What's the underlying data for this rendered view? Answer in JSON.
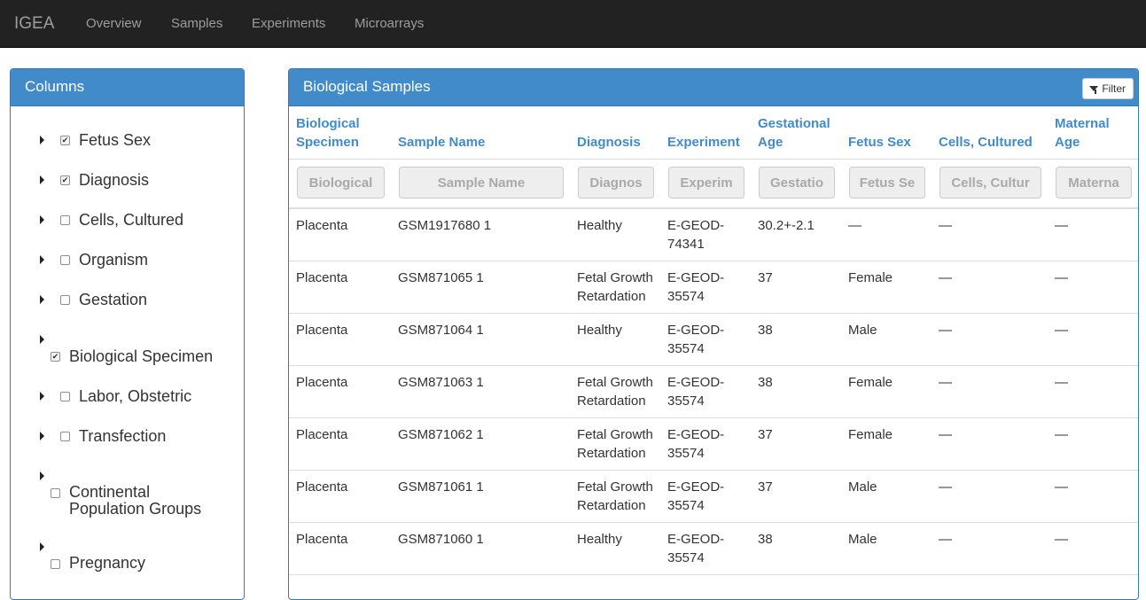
{
  "navbar": {
    "brand": "IGEA",
    "links": [
      "Overview",
      "Samples",
      "Experiments",
      "Microarrays"
    ]
  },
  "columns_panel": {
    "title": "Columns",
    "items": [
      {
        "label": "Fetus Sex",
        "checked": true
      },
      {
        "label": "Diagnosis",
        "checked": true
      },
      {
        "label": "Cells, Cultured",
        "checked": false
      },
      {
        "label": "Organism",
        "checked": false
      },
      {
        "label": "Gestation",
        "checked": false
      },
      {
        "label": "Biological Specimen",
        "checked": true
      },
      {
        "label": "Labor, Obstetric",
        "checked": false
      },
      {
        "label": "Transfection",
        "checked": false
      },
      {
        "label_line1": "Continental",
        "label_line2": "Population Groups",
        "checked": false
      },
      {
        "label": "Pregnancy",
        "checked": false
      }
    ]
  },
  "samples_panel": {
    "title": "Biological Samples",
    "filter_label": "Filter",
    "headers": [
      {
        "line1": "Biological",
        "line2": "Specimen"
      },
      {
        "line1": "",
        "line2": "Sample Name"
      },
      {
        "line1": "",
        "line2": "Diagnosis"
      },
      {
        "line1": "",
        "line2": "Experiment"
      },
      {
        "line1": "Gestational",
        "line2": "Age"
      },
      {
        "line1": "",
        "line2": "Fetus Sex"
      },
      {
        "line1": "",
        "line2": "Cells, Cultured"
      },
      {
        "line1": "Maternal",
        "line2": "Age"
      }
    ],
    "filters": [
      "Biological",
      "Sample Name",
      "Diagnos",
      "Experim",
      "Gestatio",
      "Fetus Se",
      "Cells, Cultur",
      "Materna"
    ],
    "rows": [
      {
        "specimen": "Placenta",
        "sample": "GSM1917680 1",
        "diag1": "Healthy",
        "diag2": "",
        "exp1": "E-GEOD-",
        "exp2": "74341",
        "age": "30.2+-2.1",
        "sex": "—",
        "cells": "—",
        "maternal": "—"
      },
      {
        "specimen": "Placenta",
        "sample": "GSM871065 1",
        "diag1": "Fetal Growth",
        "diag2": "Retardation",
        "exp1": "E-GEOD-",
        "exp2": "35574",
        "age": "37",
        "sex": "Female",
        "cells": "—",
        "maternal": "—"
      },
      {
        "specimen": "Placenta",
        "sample": "GSM871064 1",
        "diag1": "Healthy",
        "diag2": "",
        "exp1": "E-GEOD-",
        "exp2": "35574",
        "age": "38",
        "sex": "Male",
        "cells": "—",
        "maternal": "—"
      },
      {
        "specimen": "Placenta",
        "sample": "GSM871063 1",
        "diag1": "Fetal Growth",
        "diag2": "Retardation",
        "exp1": "E-GEOD-",
        "exp2": "35574",
        "age": "38",
        "sex": "Female",
        "cells": "—",
        "maternal": "—"
      },
      {
        "specimen": "Placenta",
        "sample": "GSM871062 1",
        "diag1": "Fetal Growth",
        "diag2": "Retardation",
        "exp1": "E-GEOD-",
        "exp2": "35574",
        "age": "37",
        "sex": "Female",
        "cells": "—",
        "maternal": "—"
      },
      {
        "specimen": "Placenta",
        "sample": "GSM871061 1",
        "diag1": "Fetal Growth",
        "diag2": "Retardation",
        "exp1": "E-GEOD-",
        "exp2": "35574",
        "age": "37",
        "sex": "Male",
        "cells": "—",
        "maternal": "—"
      },
      {
        "specimen": "Placenta",
        "sample": "GSM871060 1",
        "diag1": "Healthy",
        "diag2": "",
        "exp1": "E-GEOD-",
        "exp2": "35574",
        "age": "38",
        "sex": "Male",
        "cells": "—",
        "maternal": "—"
      }
    ]
  }
}
